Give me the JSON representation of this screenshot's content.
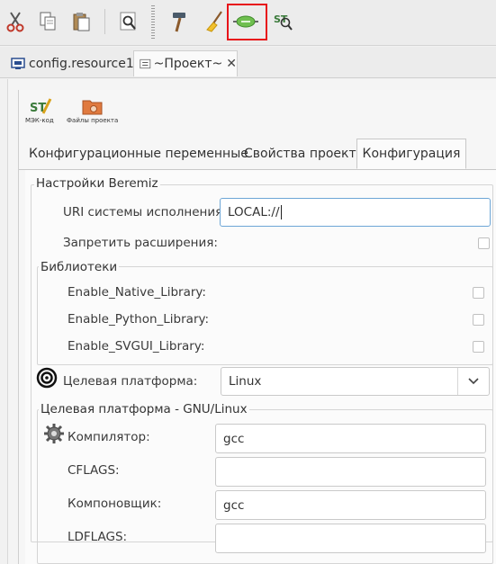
{
  "toolbar": {
    "icons": [
      "cut-icon",
      "copy-icon",
      "paste-icon",
      "search-icon",
      "build-icon",
      "clean-icon",
      "connect-icon",
      "transfer-icon"
    ]
  },
  "doc_tabs": [
    {
      "label": "config.resource1"
    },
    {
      "label": "~Проект~"
    }
  ],
  "project_buttons": [
    {
      "label": "МЭК-код"
    },
    {
      "label": "Файлы проекта"
    }
  ],
  "sub_tabs": [
    {
      "label": "Конфигурационные переменные"
    },
    {
      "label": "Свойства проекта"
    },
    {
      "label": "Конфигурация"
    }
  ],
  "beremiz": {
    "title": "Настройки Beremiz",
    "uri_label": "URI системы исполнения:",
    "uri_value": "LOCAL://",
    "disable_ext_label": "Запретить расширения:"
  },
  "libraries": {
    "title": "Библиотеки",
    "items": [
      {
        "label": "Enable_Native_Library:",
        "checked": false
      },
      {
        "label": "Enable_Python_Library:",
        "checked": false
      },
      {
        "label": "Enable_SVGUI_Library:",
        "checked": false
      }
    ]
  },
  "target": {
    "label": "Целевая платформа:",
    "value": "Linux"
  },
  "gnu": {
    "title": "Целевая платформа - GNU/Linux",
    "compiler_label": "Компилятор:",
    "compiler_value": "gcc",
    "cflags_label": "CFLAGS:",
    "cflags_value": "",
    "linker_label": "Компоновщик:",
    "linker_value": "gcc",
    "ldflags_label": "LDFLAGS:",
    "ldflags_value": ""
  },
  "colors": {
    "highlight": "#e8141a",
    "focus_border": "#6da6d6"
  }
}
